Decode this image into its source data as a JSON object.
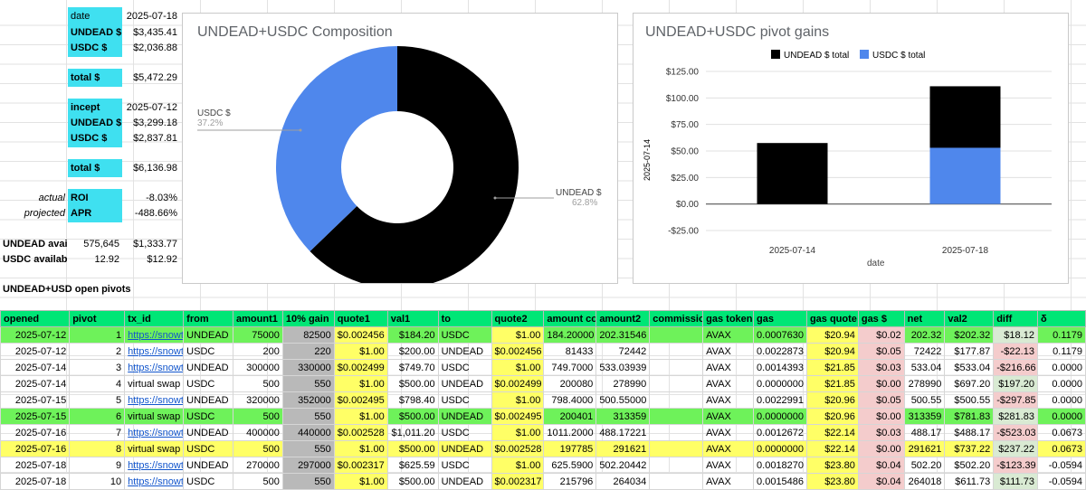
{
  "summary": {
    "date_label": "date",
    "date_value": "2025-07-18",
    "undead_label": "UNDEAD $",
    "undead_value": "$3,435.41",
    "usdc_label": "USDC $",
    "usdc_value": "$2,036.88",
    "total_label": "total $",
    "total_value": "$5,472.29",
    "incept_label": "incept",
    "incept_value": "2025-07-12",
    "incept_undead_label": "UNDEAD $",
    "incept_undead_value": "$3,299.18",
    "incept_usdc_label": "USDC $",
    "incept_usdc_value": "$2,837.81",
    "incept_total_label": "total $",
    "incept_total_value": "$6,136.98",
    "actual_label": "actual",
    "roi_label": "ROI",
    "roi_value": "-8.03%",
    "projected_label": "projected",
    "apr_label": "APR",
    "apr_value": "-488.66%",
    "undead_avail_label": "UNDEAD avail",
    "undead_avail_qty": "575,645",
    "undead_avail_value": "$1,333.77",
    "usdc_avail_label": "USDC availabl",
    "usdc_avail_qty": "12.92",
    "usdc_avail_value": "$12.92",
    "open_pivots_label": "UNDEAD+USD open pivots"
  },
  "chart_data": [
    {
      "type": "pie",
      "title": "UNDEAD+USDC Composition",
      "donut": true,
      "slices": [
        {
          "name": "UNDEAD $",
          "value": 62.8,
          "label": "62.8%",
          "color": "#000000"
        },
        {
          "name": "USDC $",
          "value": 37.2,
          "label": "37.2%",
          "color": "#4f87ec"
        }
      ]
    },
    {
      "type": "bar",
      "stacked": true,
      "title": "UNDEAD+USDC pivot gains",
      "categories": [
        "2025-07-14",
        "2025-07-18"
      ],
      "series": [
        {
          "name": "UNDEAD $ total",
          "values": [
            57.5,
            58
          ],
          "color": "#000000"
        },
        {
          "name": "USDC $ total",
          "values": [
            0,
            53
          ],
          "color": "#4f87ec"
        }
      ],
      "xlabel": "date",
      "ylabel": "2025-07-14",
      "ylim": [
        -25,
        125
      ],
      "yticks": [
        "$125.00",
        "$100.00",
        "$75.00",
        "$50.00",
        "$25.00",
        "$0.00",
        "-$25.00"
      ],
      "legend": "top"
    }
  ],
  "table": {
    "headers": [
      "opened",
      "pivot",
      "tx_id",
      "from",
      "amount1",
      "10% gain",
      "quote1",
      "val1",
      "to",
      "quote2",
      "amount co",
      "amount2",
      "commission",
      "gas token",
      "gas",
      "gas quote",
      "gas $",
      "net",
      "val2",
      "diff",
      "δ"
    ],
    "rows": [
      [
        "2025-07-12",
        "1",
        "https://snowtr",
        "UNDEAD",
        "75000",
        "82500",
        "$0.002456",
        "$184.20",
        "USDC",
        "$1.00",
        "184.20000",
        "202.31546",
        "",
        "AVAX",
        "0.0007630",
        "$20.94",
        "$0.02",
        "202.32",
        "$202.32",
        "$18.12",
        "0.1179"
      ],
      [
        "2025-07-12",
        "2",
        "https://snowtr",
        "USDC",
        "200",
        "220",
        "$1.00",
        "$200.00",
        "UNDEAD",
        "$0.002456",
        "81433",
        "72442",
        "",
        "AVAX",
        "0.0022873",
        "$20.94",
        "$0.05",
        "72422",
        "$177.87",
        "-$22.13",
        "0.1179"
      ],
      [
        "2025-07-14",
        "3",
        "https://snowtr",
        "UNDEAD",
        "300000",
        "330000",
        "$0.002499",
        "$749.70",
        "USDC",
        "$1.00",
        "749.7000",
        "533.03939",
        "",
        "AVAX",
        "0.0014393",
        "$21.85",
        "$0.03",
        "533.04",
        "$533.04",
        "-$216.66",
        "0.0000"
      ],
      [
        "2025-07-14",
        "4",
        "virtual swap",
        "USDC",
        "500",
        "550",
        "$1.00",
        "$500.00",
        "UNDEAD",
        "$0.002499",
        "200080",
        "278990",
        "",
        "AVAX",
        "0.0000000",
        "$21.85",
        "$0.00",
        "278990",
        "$697.20",
        "$197.20",
        "0.0000"
      ],
      [
        "2025-07-15",
        "5",
        "https://snowtr",
        "UNDEAD",
        "320000",
        "352000",
        "$0.002495",
        "$798.40",
        "USDC",
        "$1.00",
        "798.4000",
        "500.55000",
        "",
        "AVAX",
        "0.0022991",
        "$20.96",
        "$0.05",
        "500.55",
        "$500.55",
        "-$297.85",
        "0.0000"
      ],
      [
        "2025-07-15",
        "6",
        "virtual swap",
        "USDC",
        "500",
        "550",
        "$1.00",
        "$500.00",
        "UNDEAD",
        "$0.002495",
        "200401",
        "313359",
        "",
        "AVAX",
        "0.0000000",
        "$20.96",
        "$0.00",
        "313359",
        "$781.83",
        "$281.83",
        "0.0000"
      ],
      [
        "2025-07-16",
        "7",
        "https://snowtr",
        "UNDEAD",
        "400000",
        "440000",
        "$0.002528",
        "$1,011.20",
        "USDC",
        "$1.00",
        "1011.2000",
        "488.17221",
        "",
        "AVAX",
        "0.0012672",
        "$22.14",
        "$0.03",
        "488.17",
        "$488.17",
        "-$523.03",
        "0.0673"
      ],
      [
        "2025-07-16",
        "8",
        "virtual swap",
        "USDC",
        "500",
        "550",
        "$1.00",
        "$500.00",
        "UNDEAD",
        "$0.002528",
        "197785",
        "291621",
        "",
        "AVAX",
        "0.0000000",
        "$22.14",
        "$0.00",
        "291621",
        "$737.22",
        "$237.22",
        "0.0673"
      ],
      [
        "2025-07-18",
        "9",
        "https://snowtr",
        "UNDEAD",
        "270000",
        "297000",
        "$0.002317",
        "$625.59",
        "USDC",
        "$1.00",
        "625.5900",
        "502.20442",
        "",
        "AVAX",
        "0.0018270",
        "$23.80",
        "$0.04",
        "502.20",
        "$502.20",
        "-$123.39",
        "-0.0594"
      ],
      [
        "2025-07-18",
        "10",
        "https://snowtr",
        "USDC",
        "500",
        "550",
        "$1.00",
        "$500.00",
        "UNDEAD",
        "$0.002317",
        "215796",
        "264034",
        "",
        "AVAX",
        "0.0015486",
        "$23.80",
        "$0.04",
        "264018",
        "$611.73",
        "$111.73",
        "-0.0594"
      ]
    ]
  }
}
